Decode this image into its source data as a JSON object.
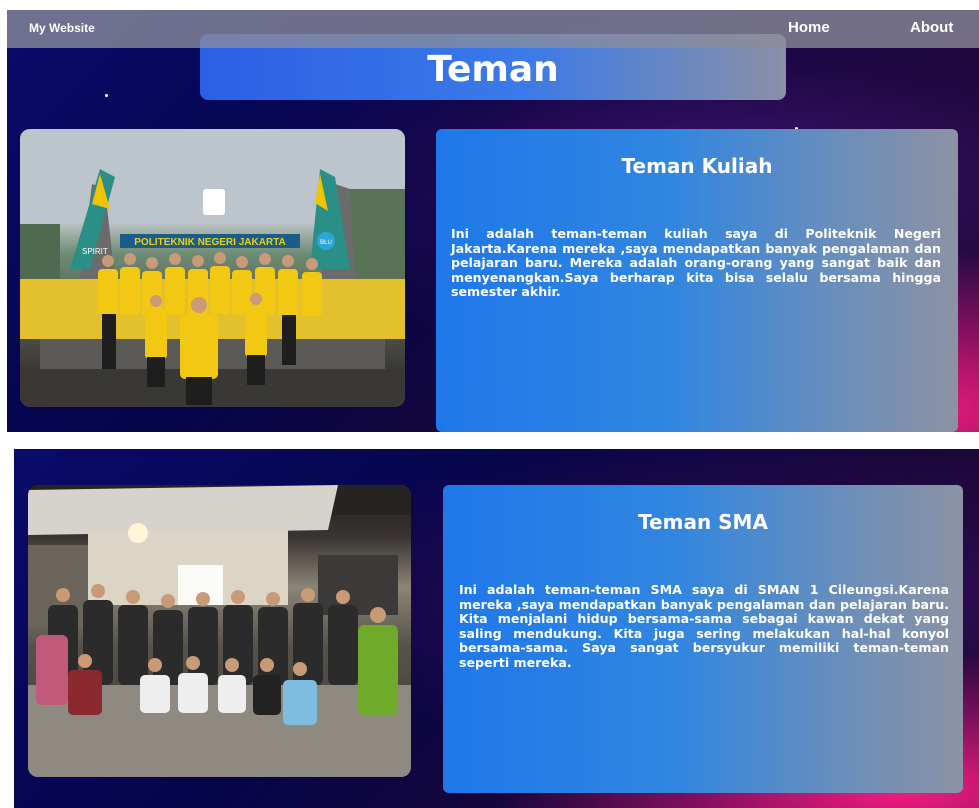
{
  "navbar": {
    "brand": "My Website",
    "links": [
      "Home",
      "About"
    ]
  },
  "page": {
    "title": "Teman"
  },
  "sections": [
    {
      "heading": "Teman Kuliah",
      "text": "Ini adalah teman-teman kuliah saya di Politeknik Negeri Jakarta.Karena mereka ,saya mendapatkan banyak pengalaman dan pelajaran baru. Mereka adalah orang-orang yang sangat baik dan menyenangkan.Saya berharap kita bisa selalu bersama hingga semester akhir.",
      "photo_signs": [
        "POLITEKNIK NEGERI JAKARTA",
        "SPIRIT",
        "BLU"
      ]
    },
    {
      "heading": "Teman SMA",
      "text": "Ini adalah teman-teman SMA saya di SMAN 1 Cileungsi.Karena mereka ,saya mendapatkan banyak pengalaman dan pelajaran baru. Kita menjalani hidup bersama-sama sebagai kawan dekat yang saling mendukung. Kita juga sering melakukan hal-hal konyol bersama-sama. Saya sangat bersyukur memiliki teman-teman seperti mereka."
    }
  ],
  "colors": {
    "card_start": "#1e78ea",
    "card_end": "#8c92a4",
    "accent_pink": "#ff1e82",
    "background_navy": "#0a0a6a"
  }
}
